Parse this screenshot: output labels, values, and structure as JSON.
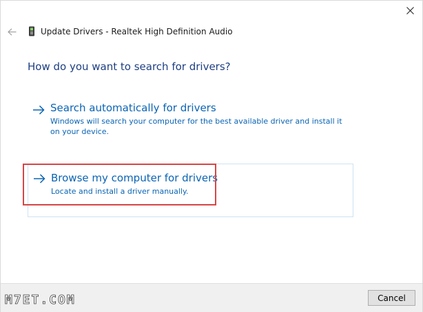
{
  "window": {
    "title": "Update Drivers - Realtek High Definition Audio"
  },
  "icons": {
    "close": "close-icon",
    "back": "back-arrow-icon",
    "device": "audio-device-icon",
    "option_arrow": "right-arrow-icon"
  },
  "main": {
    "question": "How do you want to search for drivers?",
    "options": [
      {
        "title": "Search automatically for drivers",
        "description": "Windows will search your computer for the best available driver and install it on your device."
      },
      {
        "title": "Browse my computer for drivers",
        "description": "Locate and install a driver manually."
      }
    ]
  },
  "footer": {
    "watermark": "M7ET.COM",
    "cancel_label": "Cancel"
  },
  "colors": {
    "accent": "#0a64b4",
    "heading": "#1e3f82",
    "highlight": "#d64545",
    "footer_bg": "#f0f0f0"
  }
}
